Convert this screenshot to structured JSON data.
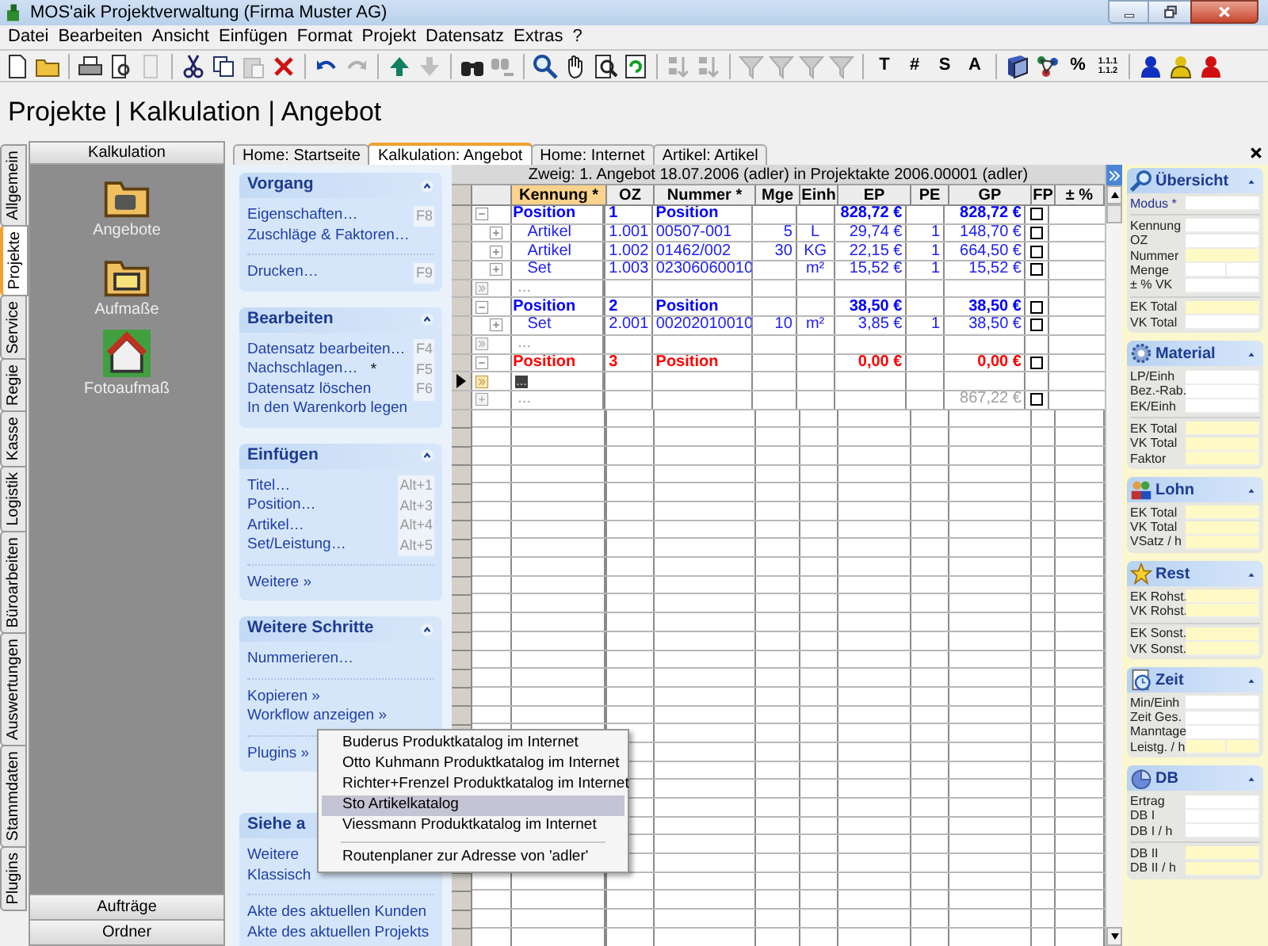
{
  "window": {
    "title": "MOS'aik Projektverwaltung (Firma Muster AG)"
  },
  "menu": [
    "Datei",
    "Bearbeiten",
    "Ansicht",
    "Einfügen",
    "Format",
    "Projekt",
    "Datensatz",
    "Extras",
    "?"
  ],
  "toolbar": [
    {
      "kind": "icon",
      "disabled": false
    },
    {
      "kind": "icon",
      "disabled": false
    },
    {
      "kind": "separator"
    },
    {
      "kind": "icon",
      "disabled": false
    },
    {
      "kind": "icon",
      "disabled": false
    },
    {
      "kind": "icon",
      "disabled": true
    },
    {
      "kind": "separator"
    },
    {
      "kind": "icon",
      "disabled": false
    },
    {
      "kind": "icon",
      "disabled": false
    },
    {
      "kind": "icon",
      "disabled": true
    },
    {
      "kind": "icon",
      "disabled": false
    },
    {
      "kind": "separator"
    },
    {
      "kind": "icon",
      "disabled": false
    },
    {
      "kind": "icon",
      "disabled": true
    },
    {
      "kind": "separator"
    },
    {
      "kind": "icon",
      "disabled": false
    },
    {
      "kind": "icon",
      "disabled": true
    },
    {
      "kind": "separator"
    },
    {
      "kind": "icon",
      "disabled": false
    },
    {
      "kind": "icon",
      "disabled": true
    },
    {
      "kind": "separator"
    },
    {
      "kind": "icon",
      "disabled": false
    },
    {
      "kind": "icon",
      "disabled": false
    },
    {
      "kind": "icon",
      "disabled": false
    },
    {
      "kind": "icon",
      "disabled": false
    },
    {
      "kind": "separator"
    },
    {
      "kind": "icon",
      "disabled": true
    },
    {
      "kind": "icon",
      "disabled": true
    },
    {
      "kind": "separator"
    },
    {
      "kind": "icon",
      "disabled": true
    },
    {
      "kind": "icon",
      "disabled": true
    },
    {
      "kind": "icon",
      "disabled": true
    },
    {
      "kind": "icon",
      "disabled": true
    },
    {
      "kind": "separator"
    },
    {
      "kind": "text",
      "label": "T"
    },
    {
      "kind": "text",
      "label": "#"
    },
    {
      "kind": "text",
      "label": "S"
    },
    {
      "kind": "text",
      "label": "A"
    },
    {
      "kind": "separator"
    },
    {
      "kind": "icon",
      "disabled": false
    },
    {
      "kind": "icon",
      "disabled": false
    },
    {
      "kind": "text",
      "label": "%"
    },
    {
      "kind": "stack",
      "lines": [
        "1.1.1",
        "1.1.2"
      ]
    },
    {
      "kind": "separator"
    },
    {
      "kind": "icon",
      "disabled": false
    },
    {
      "kind": "icon",
      "disabled": false
    },
    {
      "kind": "icon",
      "disabled": false
    }
  ],
  "heading": "Projekte | Kalkulation | Angebot",
  "side_tabs": [
    {
      "label": "Allgemein",
      "selected": false
    },
    {
      "label": "Projekte",
      "selected": true
    },
    {
      "label": "Service",
      "selected": false
    },
    {
      "label": "Regie",
      "selected": false
    },
    {
      "label": "Kasse",
      "selected": false
    },
    {
      "label": "Logistik",
      "selected": false
    },
    {
      "label": "Büroarbeiten",
      "selected": false
    },
    {
      "label": "Auswertungen",
      "selected": false
    },
    {
      "label": "Stammdaten",
      "selected": false
    },
    {
      "label": "Plugins",
      "selected": false
    }
  ],
  "sidebar": {
    "title": "Kalkulation",
    "items": [
      "Angebote",
      "Aufmaße",
      "Fotoaufmaß"
    ],
    "buttons": [
      "Aufträge",
      "Ordner"
    ]
  },
  "tabs": [
    {
      "label": "Home: Startseite",
      "selected": false
    },
    {
      "label": "Kalkulation: Angebot",
      "selected": true
    },
    {
      "label": "Home: Internet",
      "selected": false
    },
    {
      "label": "Artikel: Artikel",
      "selected": false
    }
  ],
  "task_panel": [
    {
      "title": "Vorgang",
      "groups": [
        [
          {
            "label": "Eigenschaften…",
            "shortcut": "F8"
          },
          {
            "label": "Zuschläge & Faktoren…"
          }
        ],
        [
          {
            "label": "Drucken…",
            "shortcut": "F9"
          }
        ]
      ]
    },
    {
      "title": "Bearbeiten",
      "groups": [
        [
          {
            "label": "Datensatz bearbeiten…",
            "shortcut": "F4"
          },
          {
            "label": "Nachschlagen…",
            "mark": "*",
            "shortcut": "F5"
          },
          {
            "label": "Datensatz löschen",
            "shortcut": "F6"
          },
          {
            "label": "In den Warenkorb legen"
          }
        ]
      ]
    },
    {
      "title": "Einfügen",
      "groups": [
        [
          {
            "label": "Titel…",
            "shortcut": "Alt+1"
          },
          {
            "label": "Position…",
            "shortcut": "Alt+3"
          },
          {
            "label": "Artikel…",
            "shortcut": "Alt+4"
          },
          {
            "label": "Set/Leistung…",
            "shortcut": "Alt+5"
          }
        ],
        [
          {
            "label": "Weitere »"
          }
        ]
      ]
    },
    {
      "title": "Weitere Schritte",
      "groups": [
        [
          {
            "label": "Nummerieren…"
          }
        ],
        [
          {
            "label": "Kopieren »"
          },
          {
            "label": "Workflow anzeigen »"
          }
        ],
        [
          {
            "label": "Plugins »"
          }
        ]
      ]
    },
    {
      "title": "Siehe a",
      "groups": [
        [
          {
            "label": "Weitere"
          },
          {
            "label": "Klassisch"
          }
        ],
        [
          {
            "label": "Akte des aktuellen Kunden"
          },
          {
            "label": "Akte des aktuellen Projekts"
          }
        ]
      ]
    }
  ],
  "grid": {
    "caption": "Zweig: 1. Angebot 18.07.2006 (adler) in Projektakte 2006.00001 (adler)",
    "columns": [
      {
        "label": "Kennung *",
        "selected": true
      },
      {
        "label": "OZ",
        "selected": false
      },
      {
        "label": "Nummer *",
        "selected": false
      },
      {
        "label": "Mge",
        "selected": false
      },
      {
        "label": "Einh",
        "selected": false
      },
      {
        "label": "EP",
        "selected": false
      },
      {
        "label": "PE",
        "selected": false
      },
      {
        "label": "GP",
        "selected": false
      },
      {
        "label": "FP",
        "selected": false
      },
      {
        "label": "± %",
        "selected": false
      }
    ],
    "rows": [
      {
        "kind": "position",
        "color": "#0000ff",
        "kennung": "Position",
        "oz": "1",
        "nummer": "Position",
        "ep": "828,72 €",
        "gp": "828,72 €",
        "fp": false
      },
      {
        "kind": "item",
        "color": "#2020f0",
        "kennung": "Artikel",
        "oz": "1.001",
        "nummer": "00507-001",
        "mge": "5",
        "einh": "L",
        "ep": "29,74 €",
        "pe": "1",
        "gp": "148,70 €",
        "fp": false
      },
      {
        "kind": "item",
        "color": "#2020f0",
        "kennung": "Artikel",
        "oz": "1.002",
        "nummer": "01462/002",
        "mge": "30",
        "einh": "KG",
        "ep": "22,15 €",
        "pe": "1",
        "gp": "664,50 €",
        "fp": false
      },
      {
        "kind": "item",
        "color": "#2020f0",
        "kennung": "Set",
        "oz": "1.003",
        "nummer": "02306060010",
        "einh": "m²",
        "ep": "15,52 €",
        "pe": "1",
        "gp": "15,52 €",
        "fp": false
      },
      {
        "kind": "more",
        "color": "#a0a0a0",
        "kennung": "..."
      },
      {
        "kind": "position",
        "color": "#0000ff",
        "kennung": "Position",
        "oz": "2",
        "nummer": "Position",
        "ep": "38,50 €",
        "gp": "38,50 €",
        "fp": false
      },
      {
        "kind": "item",
        "color": "#2020f0",
        "kennung": "Set",
        "oz": "2.001",
        "nummer": "00202010010",
        "mge": "10",
        "einh": "m²",
        "ep": "3,85 €",
        "pe": "1",
        "gp": "38,50 €",
        "fp": false
      },
      {
        "kind": "more",
        "color": "#a0a0a0",
        "kennung": "..."
      },
      {
        "kind": "position",
        "color": "#ff0000",
        "kennung": "Position",
        "oz": "3",
        "nummer": "Position",
        "ep": "0,00 €",
        "gp": "0,00 €",
        "fp": false
      },
      {
        "kind": "current",
        "color": "#404040",
        "kennung": "..."
      },
      {
        "kind": "total",
        "color": "#a0a0a0",
        "kennung": "...",
        "gp": "867,22 €",
        "fp": false
      }
    ]
  },
  "details": [
    {
      "title": "Übersicht",
      "groups": [
        [
          {
            "label": "Modus *",
            "kind": "key",
            "readonly": false
          }
        ],
        [
          {
            "label": "Kennung",
            "readonly": false
          },
          {
            "label": "OZ",
            "readonly": false
          },
          {
            "label": "Nummer",
            "readonly": true
          },
          {
            "label": "Menge",
            "readonly": false,
            "split": true
          },
          {
            "label": "± % VK",
            "readonly": false
          }
        ],
        [
          {
            "label": "EK Total",
            "readonly": true
          },
          {
            "label": "VK Total",
            "readonly": false
          }
        ]
      ]
    },
    {
      "title": "Material",
      "groups": [
        [
          {
            "label": "LP/Einh",
            "readonly": false
          },
          {
            "label": "Bez.-Rab.",
            "readonly": false
          },
          {
            "label": "EK/Einh",
            "readonly": false
          }
        ],
        [
          {
            "label": "EK Total",
            "readonly": true
          },
          {
            "label": "VK Total",
            "readonly": true
          },
          {
            "label": "Faktor",
            "readonly": true
          }
        ]
      ]
    },
    {
      "title": "Lohn",
      "groups": [
        [
          {
            "label": "EK Total",
            "readonly": true
          },
          {
            "label": "VK Total",
            "readonly": true
          },
          {
            "label": "VSatz / h",
            "readonly": true
          }
        ]
      ]
    },
    {
      "title": "Rest",
      "groups": [
        [
          {
            "label": "EK Rohst.",
            "readonly": true
          },
          {
            "label": "VK Rohst.",
            "readonly": true
          }
        ],
        [
          {
            "label": "EK Sonst.",
            "readonly": true
          },
          {
            "label": "VK Sonst.",
            "readonly": true
          }
        ]
      ]
    },
    {
      "title": "Zeit",
      "groups": [
        [
          {
            "label": "Min/Einh",
            "readonly": false
          },
          {
            "label": "Zeit Ges.",
            "readonly": false
          },
          {
            "label": "Manntage",
            "readonly": false
          },
          {
            "label": "Leistg. / h",
            "readonly": true,
            "split": true
          }
        ]
      ]
    },
    {
      "title": "DB",
      "groups": [
        [
          {
            "label": "Ertrag",
            "readonly": false
          },
          {
            "label": "DB I",
            "readonly": false
          },
          {
            "label": "DB I / h",
            "readonly": false
          }
        ],
        [
          {
            "label": "DB II",
            "readonly": true
          },
          {
            "label": "DB II / h",
            "readonly": true
          }
        ]
      ]
    }
  ],
  "popup_menu": {
    "items": [
      {
        "label": "Buderus Produktkatalog im Internet",
        "selected": false
      },
      {
        "label": "Otto Kuhmann Produktkatalog im Internet",
        "selected": false
      },
      {
        "label": "Richter+Frenzel Produktkatalog im Internet",
        "selected": false
      },
      {
        "label": "Sto Artikelkatalog",
        "selected": true
      },
      {
        "label": "Viessmann Produktkatalog im Internet",
        "selected": false
      },
      {
        "kind": "separator"
      },
      {
        "label": "Routenplaner zur Adresse von 'adler'",
        "selected": false
      }
    ]
  }
}
